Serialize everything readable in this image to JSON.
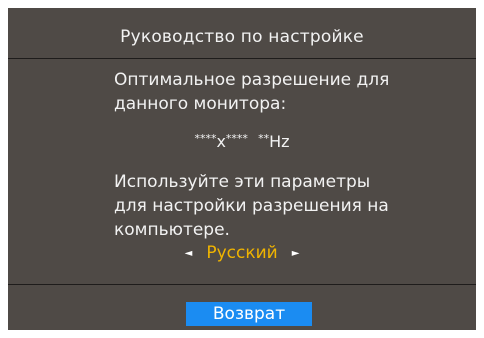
{
  "osd": {
    "title": "Руководство по настройке",
    "intro_line1": "Оптимальное разрешение для",
    "intro_line2": "данного монитора:",
    "resolution_masked_width": "****",
    "resolution_separator": "x",
    "resolution_masked_height": "****",
    "refresh_masked": "**",
    "refresh_unit": "Hz",
    "instruction_line1": "Используйте эти параметры",
    "instruction_line2": "для настройки разрешения на",
    "instruction_line3": "компьютере.",
    "language": {
      "selected": "Русский",
      "prev_icon": "◄",
      "next_icon": "►"
    },
    "return_label": "Возврат"
  },
  "colors": {
    "panel_bg": "#4f4a46",
    "divider": "#1e1c1b",
    "text": "#f2f2f2",
    "highlight": "#f0b400",
    "button_bg": "#1b8cf2"
  }
}
